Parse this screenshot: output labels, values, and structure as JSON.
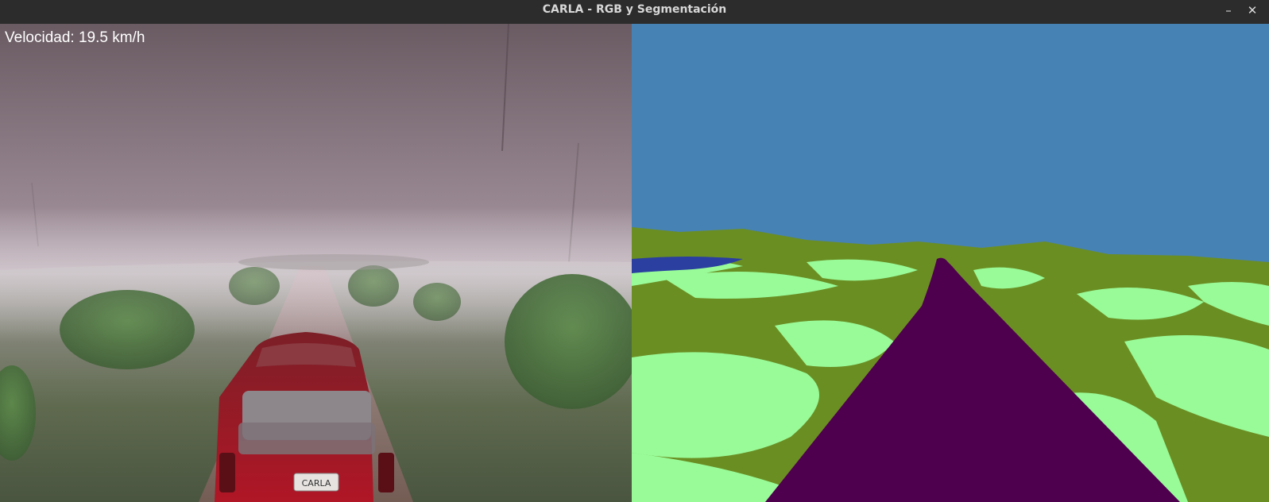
{
  "window": {
    "title": "CARLA - RGB y Segmentación",
    "minimize_symbol": "–",
    "close_symbol": "✕"
  },
  "hud": {
    "speed_text": "Velocidad: 19.5 km/h"
  },
  "rgb_view": {
    "license_plate": "CARLA"
  },
  "segmentation_colors": {
    "sky": "#4682B4",
    "vegetation": "#6B8E23",
    "terrain": "#98FB98",
    "road": "#4E004E",
    "water": "#2A3FA0"
  }
}
